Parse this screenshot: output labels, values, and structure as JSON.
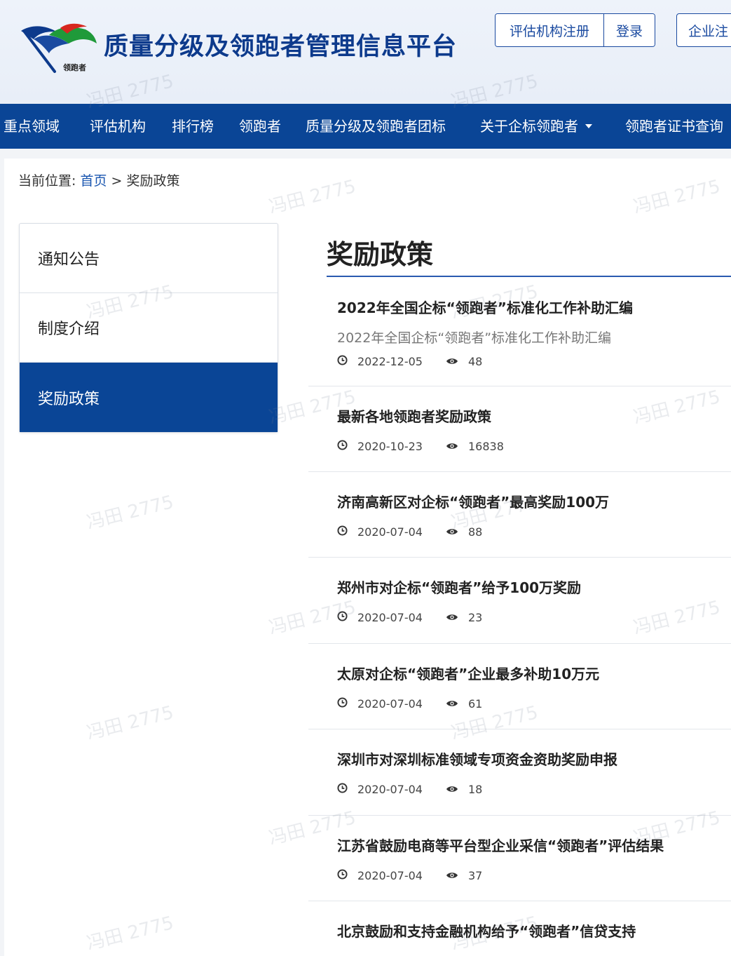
{
  "header": {
    "site_title": "质量分级及领跑者管理信息平台",
    "logo_caption": "领跑者",
    "register_button": "评估机构注册",
    "login_button": "登录",
    "enterprise_button": "企业注"
  },
  "nav": {
    "items": [
      {
        "label": "重点领域"
      },
      {
        "label": "评估机构"
      },
      {
        "label": "排行榜"
      },
      {
        "label": "领跑者"
      },
      {
        "label": "质量分级及领跑者团标"
      },
      {
        "label": "关于企标领跑者"
      },
      {
        "label": "领跑者证书查询"
      }
    ]
  },
  "breadcrumb": {
    "prefix": "当前位置:",
    "home": "首页",
    "separator": ">",
    "current": "奖励政策"
  },
  "sidebar": {
    "items": [
      {
        "label": "通知公告",
        "active": false
      },
      {
        "label": "制度介绍",
        "active": false
      },
      {
        "label": "奖励政策",
        "active": true
      }
    ]
  },
  "content": {
    "title": "奖励政策",
    "articles": [
      {
        "title": "2022年全国企标“领跑者”标准化工作补助汇编",
        "summary": "2022年全国企标“领跑者”标准化工作补助汇编",
        "date": "2022-12-05",
        "views": "48"
      },
      {
        "title": "最新各地领跑者奖励政策",
        "summary": "",
        "date": "2020-10-23",
        "views": "16838"
      },
      {
        "title": "济南高新区对企标“领跑者”最高奖励100万",
        "summary": "",
        "date": "2020-07-04",
        "views": "88"
      },
      {
        "title": "郑州市对企标“领跑者”给予100万奖励",
        "summary": "",
        "date": "2020-07-04",
        "views": "23"
      },
      {
        "title": "太原对企标“领跑者”企业最多补助10万元",
        "summary": "",
        "date": "2020-07-04",
        "views": "61"
      },
      {
        "title": "深圳市对深圳标准领域专项资金资助奖励申报",
        "summary": "",
        "date": "2020-07-04",
        "views": "18"
      },
      {
        "title": "江苏省鼓励电商等平台型企业采信“领跑者”评估结果",
        "summary": "",
        "date": "2020-07-04",
        "views": "37"
      },
      {
        "title": "北京鼓励和支持金融机构给予“领跑者”信贷支持",
        "summary": "",
        "date": "",
        "views": ""
      }
    ]
  },
  "watermark": "冯田 2775",
  "colors": {
    "brand_blue": "#0a4596",
    "link_blue": "#1a56b0",
    "title_blue": "#0d3a8c"
  }
}
